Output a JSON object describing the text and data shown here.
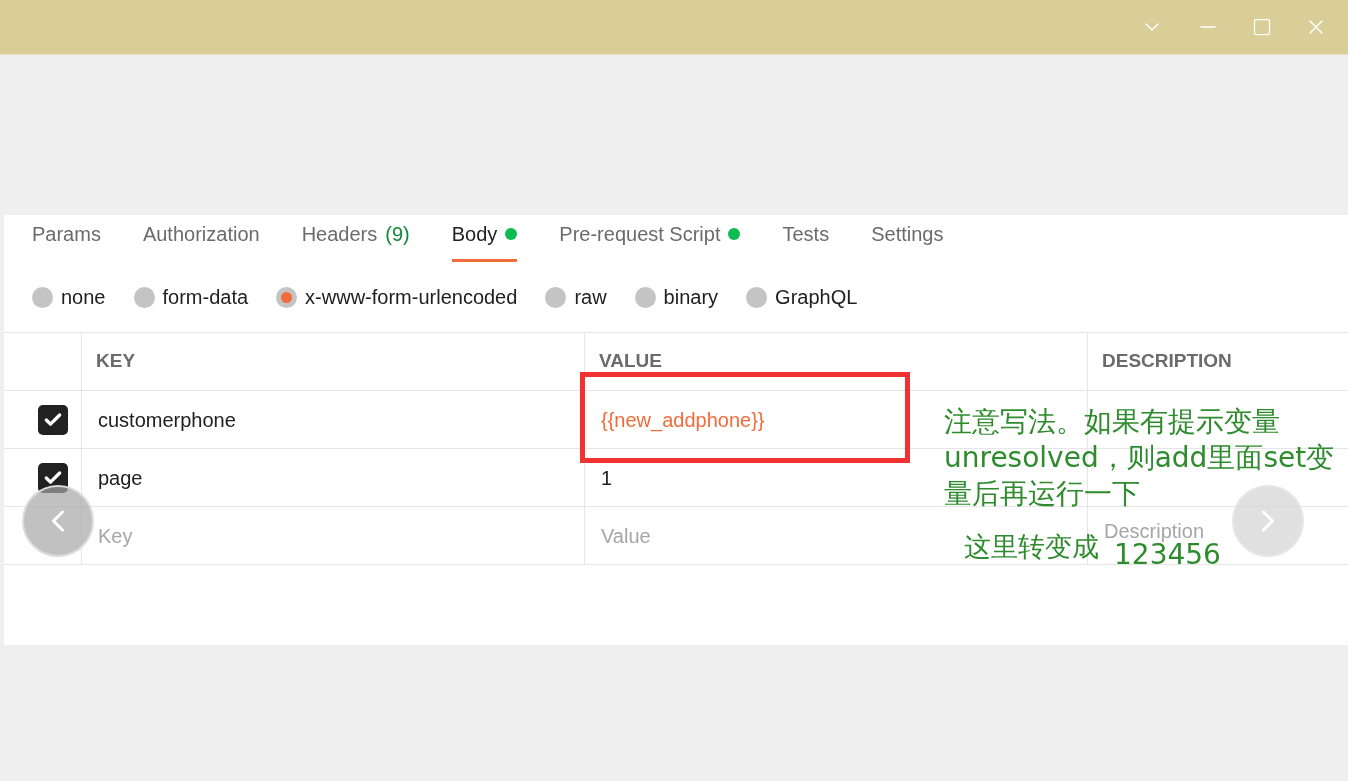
{
  "tabs": [
    {
      "label": "Params",
      "selected": false
    },
    {
      "label": "Authorization",
      "selected": false
    },
    {
      "label": "Headers",
      "count": "(9)",
      "selected": false
    },
    {
      "label": "Body",
      "dot": true,
      "selected": true
    },
    {
      "label": "Pre-request Script",
      "dot": true,
      "selected": false
    },
    {
      "label": "Tests",
      "selected": false
    },
    {
      "label": "Settings",
      "selected": false
    }
  ],
  "body_types": [
    {
      "label": "none",
      "selected": false
    },
    {
      "label": "form-data",
      "selected": false
    },
    {
      "label": "x-www-form-urlencoded",
      "selected": true
    },
    {
      "label": "raw",
      "selected": false
    },
    {
      "label": "binary",
      "selected": false
    },
    {
      "label": "GraphQL",
      "selected": false
    }
  ],
  "table": {
    "columns": [
      "KEY",
      "VALUE",
      "DESCRIPTION"
    ],
    "rows": [
      {
        "checked": true,
        "key": "customerphone",
        "value": "{{new_addphone}}",
        "kind": "variable"
      },
      {
        "checked": true,
        "key": "page",
        "value": "1",
        "kind": "plain"
      }
    ],
    "new_row": {
      "key_placeholder": "Key",
      "value_placeholder": "Value",
      "description_placeholder": "Description"
    }
  },
  "annotations": [
    {
      "text": "注意写法。如果有提示变量unresolved，则add里面set变量后再运行一下"
    },
    {
      "text": "这里转变成"
    },
    {
      "text": "123456"
    }
  ]
}
